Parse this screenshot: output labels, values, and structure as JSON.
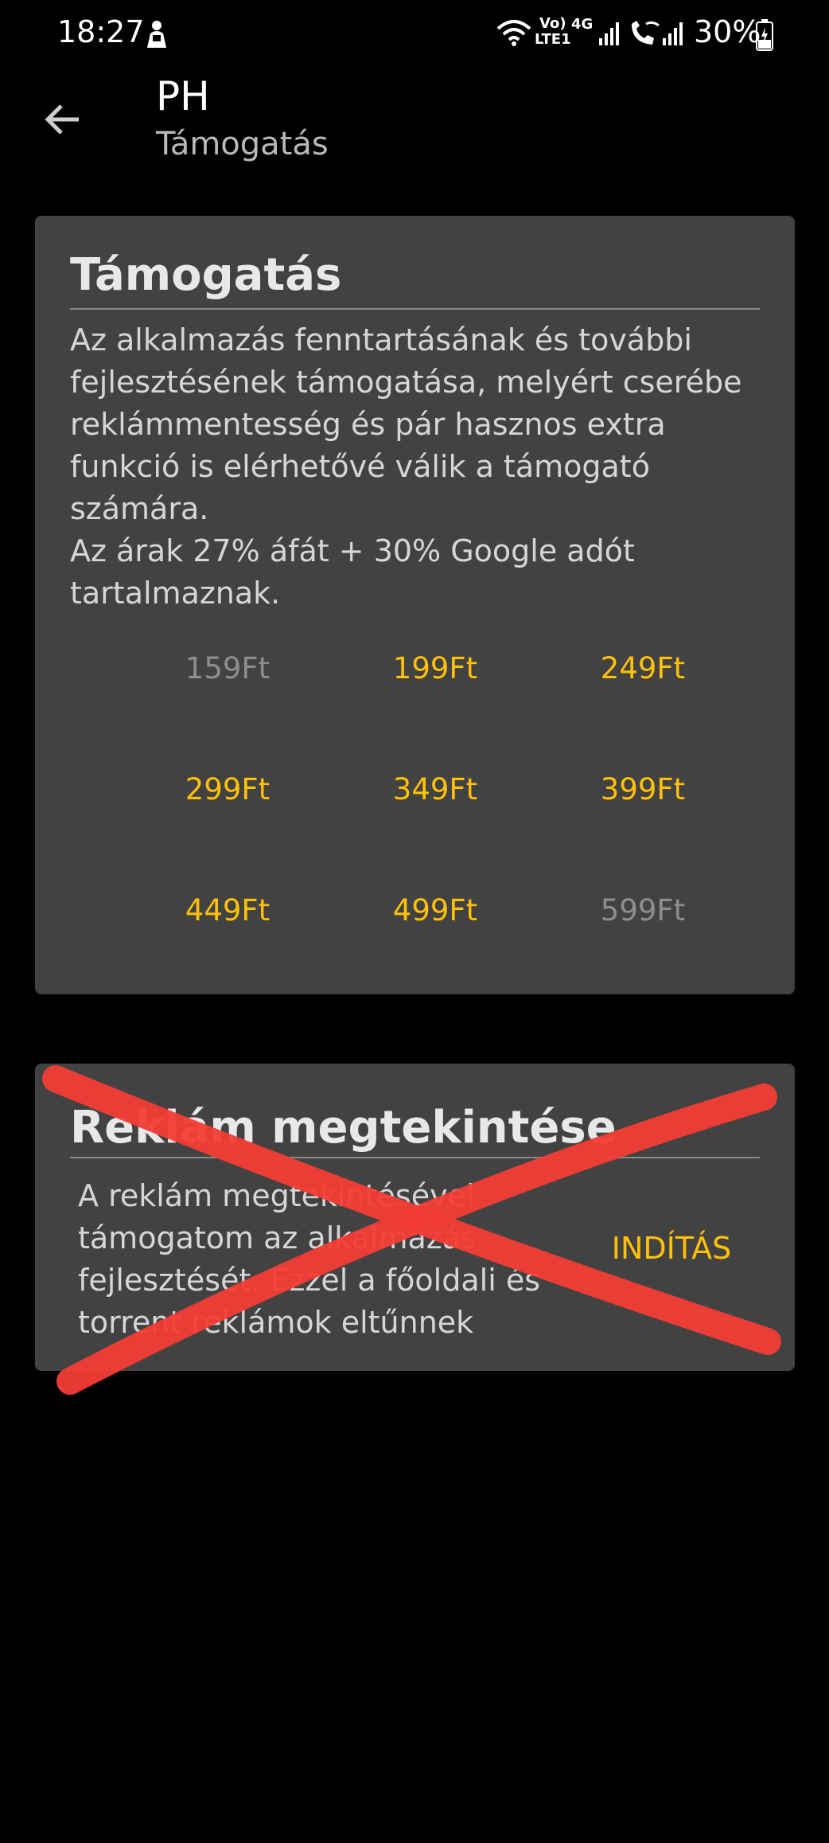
{
  "status_bar": {
    "time": "18:27",
    "battery": "30%",
    "network_labels": [
      "Vo)",
      "LTE1",
      "4G"
    ],
    "icons": [
      "notification-person-icon",
      "wifi-icon",
      "volte-icon",
      "4g-icon",
      "signal-icon",
      "wifi-calling-icon",
      "signal-icon",
      "battery-charging-icon"
    ]
  },
  "toolbar": {
    "title": "PH",
    "subtitle": "Támogatás",
    "back_icon": "arrow-back-icon"
  },
  "support_card": {
    "title": "Támogatás",
    "description_1": "Az alkalmazás fenntartásának és további fejlesztésének támogatása, melyért cserébe reklámmentesség és pár hasznos extra funkció is elérhetővé válik a támogató számára.",
    "description_2": "Az árak 27% áfát + 30% Google adót tartalmaznak.",
    "prices": [
      {
        "label": "159Ft",
        "enabled": false
      },
      {
        "label": "199Ft",
        "enabled": true
      },
      {
        "label": "249Ft",
        "enabled": true
      },
      {
        "label": "299Ft",
        "enabled": true
      },
      {
        "label": "349Ft",
        "enabled": true
      },
      {
        "label": "399Ft",
        "enabled": true
      },
      {
        "label": "449Ft",
        "enabled": true
      },
      {
        "label": "499Ft",
        "enabled": true
      },
      {
        "label": "599Ft",
        "enabled": false
      }
    ]
  },
  "ad_card": {
    "title": "Reklám megtekintése",
    "description": "A reklám megtekintésével támogatom az alkalmazás fejlesztését. Ezzel a főoldali és torrent reklámok eltűnnek",
    "button_label": "INDÍTÁS"
  },
  "colors": {
    "accent": "#ffc107",
    "disabled": "#8e8e8e",
    "card_bg": "#424242",
    "cross": "#f23d35"
  }
}
